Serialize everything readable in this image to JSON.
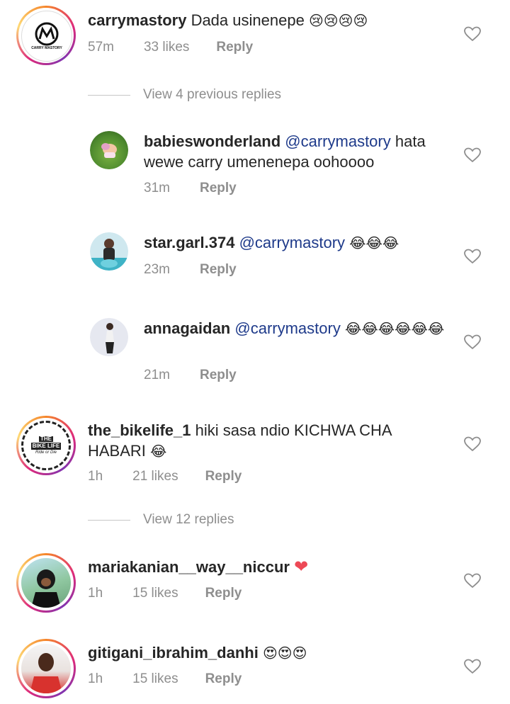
{
  "comments": [
    {
      "username": "carrymastory",
      "text": "Dada usinenepe",
      "emoji": "😢😢😢😢",
      "time": "57m",
      "likes": "33 likes",
      "reply": "Reply"
    },
    {
      "view_replies": "View 4 previous replies"
    },
    {
      "username": "babieswonderland",
      "mention": "@carrymastory",
      "text": "hata wewe carry umenenepa oohoooo",
      "time": "31m",
      "reply": "Reply"
    },
    {
      "username": "star.garl.374",
      "mention": "@carrymastory",
      "emoji": "😂😂😂",
      "time": "23m",
      "reply": "Reply"
    },
    {
      "username": "annagaidan",
      "mention": "@carrymastory",
      "emoji": "😂😂😂😂😂😂",
      "time": "21m",
      "reply": "Reply"
    },
    {
      "username": "the_bikelife_1",
      "text": "hiki sasa ndio KICHWA CHA HABARI",
      "emoji": "😂",
      "time": "1h",
      "likes": "21 likes",
      "reply": "Reply"
    },
    {
      "view_replies": "View 12 replies"
    },
    {
      "username": "mariakanian__way__niccur",
      "emoji": "❤",
      "time": "1h",
      "likes": "15 likes",
      "reply": "Reply"
    },
    {
      "username": "gitigani_ibrahim_danhi",
      "emoji": "😍😍😍",
      "time": "1h",
      "likes": "15 likes",
      "reply": "Reply"
    }
  ],
  "avatar_logo": {
    "carry_label": "CARRY MASTORY",
    "bike_top": "THE",
    "bike_mid": "BIKE LIFE",
    "bike_bottom": "Ride or Die"
  },
  "colors": {
    "mention": "#1e3a8a",
    "meta": "#8e8e8e",
    "heart_red": "#ed4956"
  }
}
